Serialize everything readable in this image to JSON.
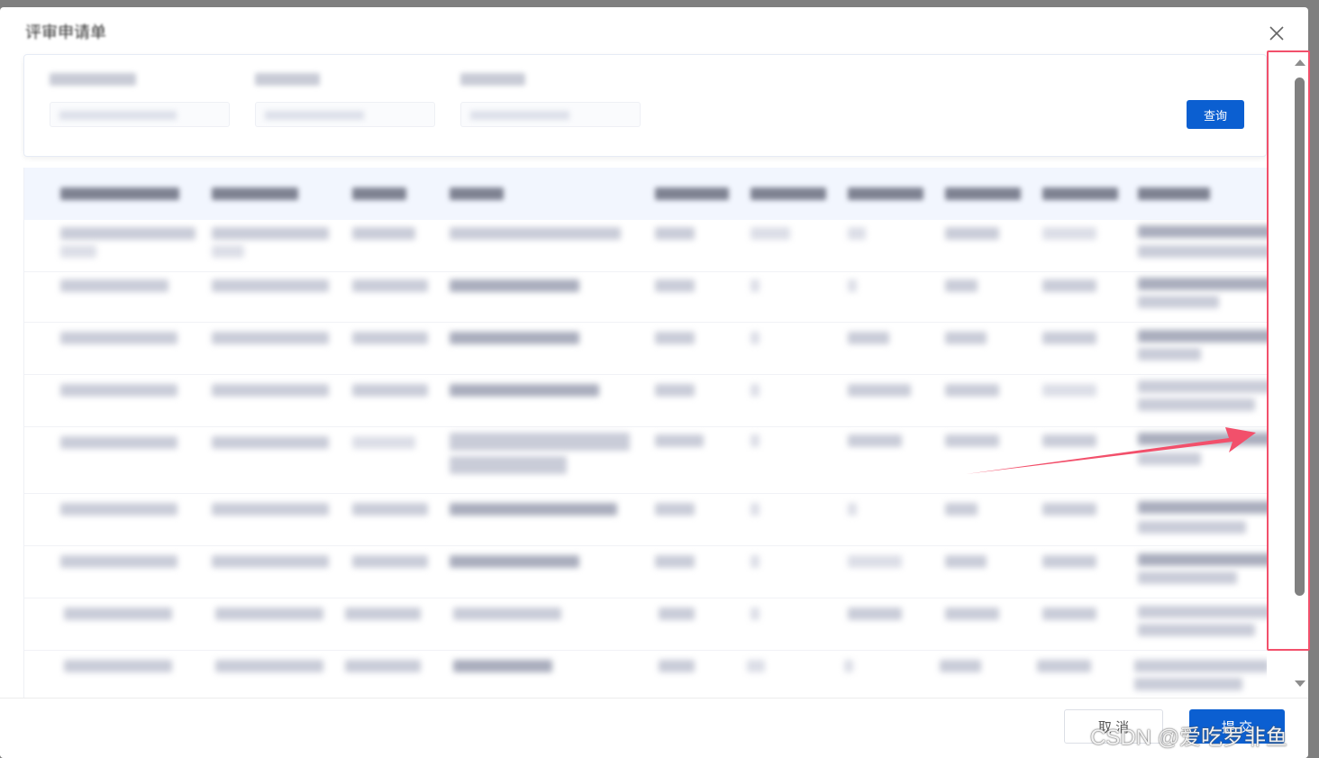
{
  "modal": {
    "title": "评审申请单",
    "close_label": "×"
  },
  "filters": {
    "query_label": "查询"
  },
  "footer": {
    "cancel_label": "取 消",
    "submit_label": "提 交"
  },
  "watermark": "CSDN @爱吃罗非鱼",
  "annotation": {
    "color": "#f2506b"
  },
  "colors": {
    "primary": "#0b5fd1",
    "header_bg": "#f2f6fe"
  }
}
